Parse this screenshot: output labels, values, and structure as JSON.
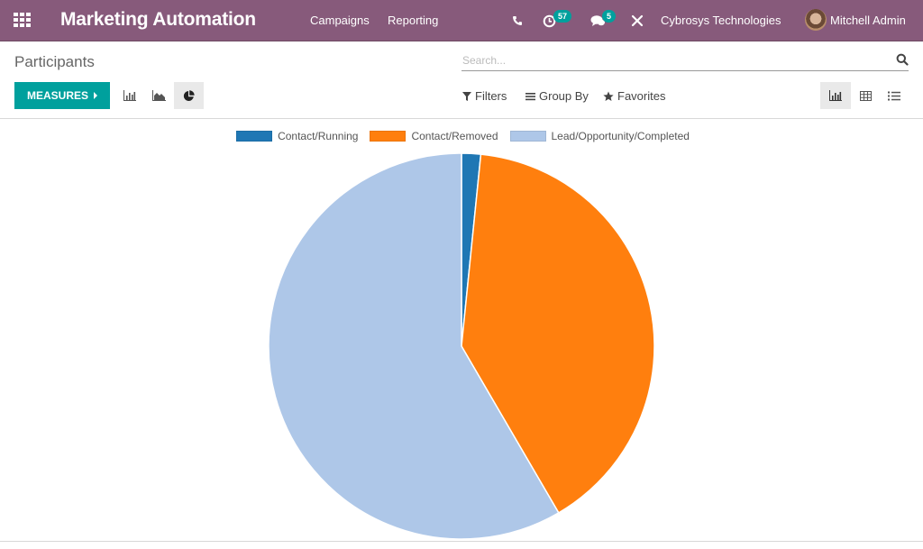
{
  "navbar": {
    "app_title": "Marketing Automation",
    "menu": [
      {
        "label": "Campaigns"
      },
      {
        "label": "Reporting"
      }
    ],
    "activity_count": "57",
    "message_count": "5",
    "company": "Cybrosys Technologies",
    "user": "Mitchell Admin",
    "icons": [
      "apps-grid-icon",
      "phone-icon",
      "activity-clock-icon",
      "chat-icon",
      "debug-tools-icon"
    ]
  },
  "control_panel": {
    "title": "Participants",
    "search_placeholder": "Search...",
    "measures_label": "MEASURES",
    "chart_modes": [
      "bar-chart",
      "line-chart",
      "pie-chart"
    ],
    "active_chart_mode": "pie-chart",
    "filters_label": "Filters",
    "group_by_label": "Group By",
    "favorites_label": "Favorites",
    "views": [
      "graph",
      "pivot",
      "list"
    ],
    "active_view": "graph"
  },
  "colors": {
    "brand": "#875A7B",
    "accent": "#00A09D"
  },
  "chart_data": {
    "type": "pie",
    "title": "",
    "legend_position": "top",
    "categories": [
      "Contact/Running",
      "Contact/Removed",
      "Lead/Opportunity/Completed"
    ],
    "values": [
      1.6,
      40.0,
      58.4
    ],
    "value_unit": "percent (estimated from slice angles)",
    "colors": [
      "#1f77b4",
      "#ff7f0e",
      "#aec7e8"
    ],
    "start_angle": "12 o'clock",
    "direction": "clockwise"
  }
}
